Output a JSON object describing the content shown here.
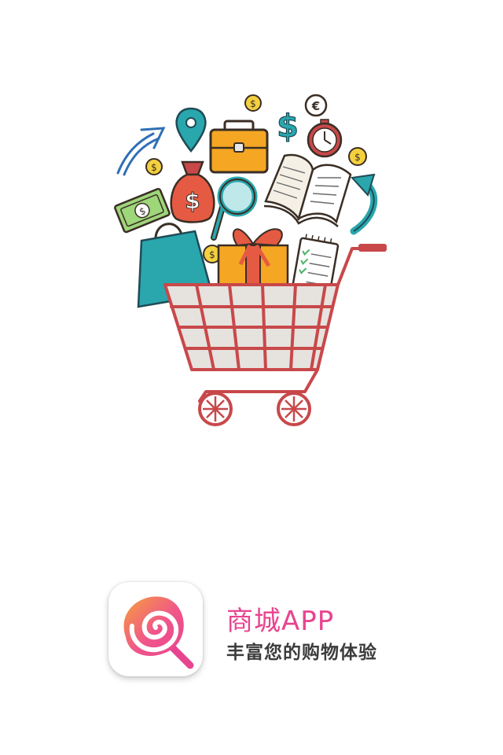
{
  "hero": {
    "illustration": "shopping-cart-with-goods",
    "currency_symbols": {
      "dollar": "$",
      "euro": "€"
    }
  },
  "brand": {
    "app_name": "商城APP",
    "tagline": "丰富您的购物体验",
    "icon": "lollipop-spiral-icon"
  },
  "colors": {
    "cart_red": "#c8484a",
    "teal": "#2aa6ad",
    "orange": "#f5a623",
    "coin_yellow": "#f4d03f",
    "brand_pink": "#e8448f",
    "tagline_gray": "#3c3c3c"
  }
}
